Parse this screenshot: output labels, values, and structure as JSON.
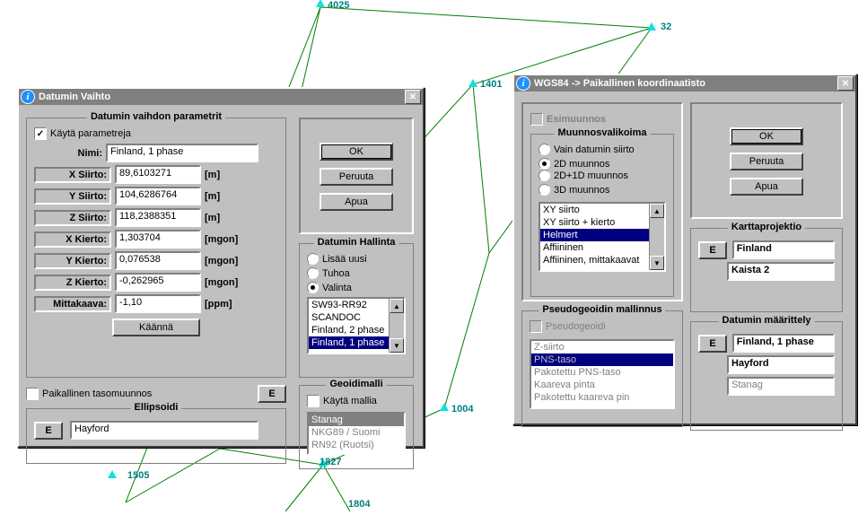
{
  "background_points": {
    "p4025": {
      "label": "4025"
    },
    "p32": {
      "label": "32"
    },
    "p1401": {
      "label": "1401"
    },
    "p1004": {
      "label": "1004"
    },
    "p1827": {
      "label": "1827"
    },
    "p1505": {
      "label": "1505"
    },
    "p1804": {
      "label": "1804"
    }
  },
  "dialog1": {
    "title": "Datumin Vaihto",
    "group_params_title": "Datumin vaihdon parametrit",
    "use_params_label": "Käytä parametreja",
    "use_params_checked": true,
    "name_label": "Nimi:",
    "name_value": "Finland, 1 phase",
    "rows": [
      {
        "label": "X Siirto:",
        "value": "89,6103271",
        "unit": "[m]"
      },
      {
        "label": "Y Siirto:",
        "value": "104,6286764",
        "unit": "[m]"
      },
      {
        "label": "Z Siirto:",
        "value": "118,2388351",
        "unit": "[m]"
      },
      {
        "label": "X Kierto:",
        "value": "1,303704",
        "unit": "[mgon]"
      },
      {
        "label": "Y Kierto:",
        "value": "0,076538",
        "unit": "[mgon]"
      },
      {
        "label": "Z Kierto:",
        "value": "-0,262965",
        "unit": "[mgon]"
      },
      {
        "label": "Mittakaava:",
        "value": "-1,10",
        "unit": "[ppm]"
      }
    ],
    "translate_btn": "Käännä",
    "local_plane_label": "Paikallinen tasomuunnos",
    "local_plane_checked": false,
    "e_btn": "E",
    "ellipsoid_title": "Ellipsoidi",
    "ellipsoid_value": "Hayford",
    "ok_btn": "OK",
    "cancel_btn": "Peruuta",
    "help_btn": "Apua",
    "mgmt_title": "Datumin Hallinta",
    "mgmt_options": {
      "add": "Lisää uusi",
      "destroy": "Tuhoa",
      "select": "Valinta"
    },
    "mgmt_selected": "select",
    "mgmt_list": [
      "SW93-RR92",
      "SCANDOC",
      "Finland, 2 phase",
      "Finland, 1 phase"
    ],
    "mgmt_list_selected": "Finland, 1 phase",
    "geoid_title": "Geoidimalli",
    "geoid_use_label": "Käytä mallia",
    "geoid_use_checked": false,
    "geoid_list": [
      "Stanag",
      "NKG89 / Suomi",
      "RN92 (Ruotsi)"
    ],
    "geoid_selected": "Stanag"
  },
  "dialog2": {
    "title": "WGS84 -> Paikallinen koordinaatisto",
    "pretrans_label": "Esimuunnos",
    "pretrans_disabled": true,
    "trans_menu_title": "Muunnosvalikoima",
    "trans_options": [
      {
        "id": "datum_only",
        "label": "Vain datumin siirto"
      },
      {
        "id": "2d",
        "label": "2D muunnos"
      },
      {
        "id": "2d1d",
        "label": "2D+1D muunnos"
      },
      {
        "id": "3d",
        "label": "3D muunnos"
      }
    ],
    "trans_selected": "2d",
    "method_list": [
      "XY siirto",
      "XY siirto + kierto",
      "Helmert",
      "Affiininen",
      "Affiininen, mittakaavat"
    ],
    "method_selected": "Helmert",
    "pseudo_title": "Pseudogeoidin mallinnus",
    "pseudo_label": "Pseudogeoidi",
    "pseudo_disabled": true,
    "pseudo_list": [
      "Z-siirto",
      "PNS-taso",
      "Pakotettu PNS-taso",
      "Kaareva pinta",
      "Pakotettu kaareva pin"
    ],
    "pseudo_selected": "PNS-taso",
    "ok_btn": "OK",
    "cancel_btn": "Peruuta",
    "help_btn": "Apua",
    "mapproj_title": "Karttaprojektio",
    "mapproj_value1": "Finland",
    "mapproj_value2": "Kaista 2",
    "datumdef_title": "Datumin määrittely",
    "datumdef_value1": "Finland, 1 phase",
    "datumdef_value2": "Hayford",
    "datumdef_value3": "Stanag",
    "e_btn": "E"
  }
}
